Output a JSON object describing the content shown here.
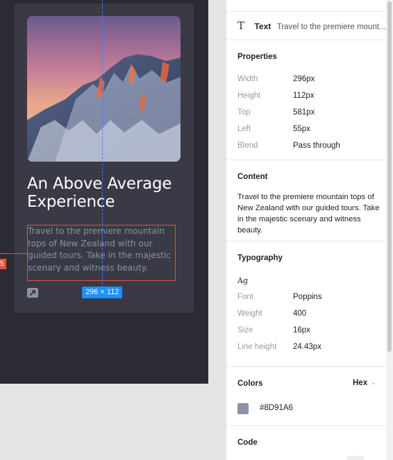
{
  "card": {
    "title": "An Above Average Experience",
    "body": "Travel to the premiere mountain tops of New Zealand with our guided tours. Take in the majestic scenary and witness beauty."
  },
  "overlay": {
    "size_label": "296 × 112",
    "distance_label": "5"
  },
  "inspector": {
    "layer": {
      "icon": "text-icon",
      "type": "Text",
      "name": "Travel to the premiere mount..."
    },
    "properties": {
      "title": "Properties",
      "rows": [
        {
          "label": "Width",
          "value": "296px"
        },
        {
          "label": "Height",
          "value": "112px"
        },
        {
          "label": "Top",
          "value": "581px"
        },
        {
          "label": "Left",
          "value": "55px"
        },
        {
          "label": "Blend",
          "value": "Pass through"
        }
      ]
    },
    "content": {
      "title": "Content",
      "text": "Travel to the premiere mountain tops of New Zealand with our guided tours. Take in the majestic scenary and witness beauty."
    },
    "typography": {
      "title": "Typography",
      "sample": "Ag",
      "rows": [
        {
          "label": "Font",
          "value": "Poppins"
        },
        {
          "label": "Weight",
          "value": "400"
        },
        {
          "label": "Size",
          "value": "16px"
        },
        {
          "label": "Line height",
          "value": "24.43px"
        }
      ]
    },
    "colors": {
      "title": "Colors",
      "format": "Hex",
      "swatch_color": "#8D91A6",
      "hex": "#8D91A6"
    },
    "code": {
      "title": "Code"
    }
  },
  "theme": {
    "canvas_bg": "#2b2c33",
    "card_bg": "#393a45",
    "selection_color": "#e5533d",
    "guide_color": "#3b82f6",
    "badge_color": "#1e90ff"
  }
}
